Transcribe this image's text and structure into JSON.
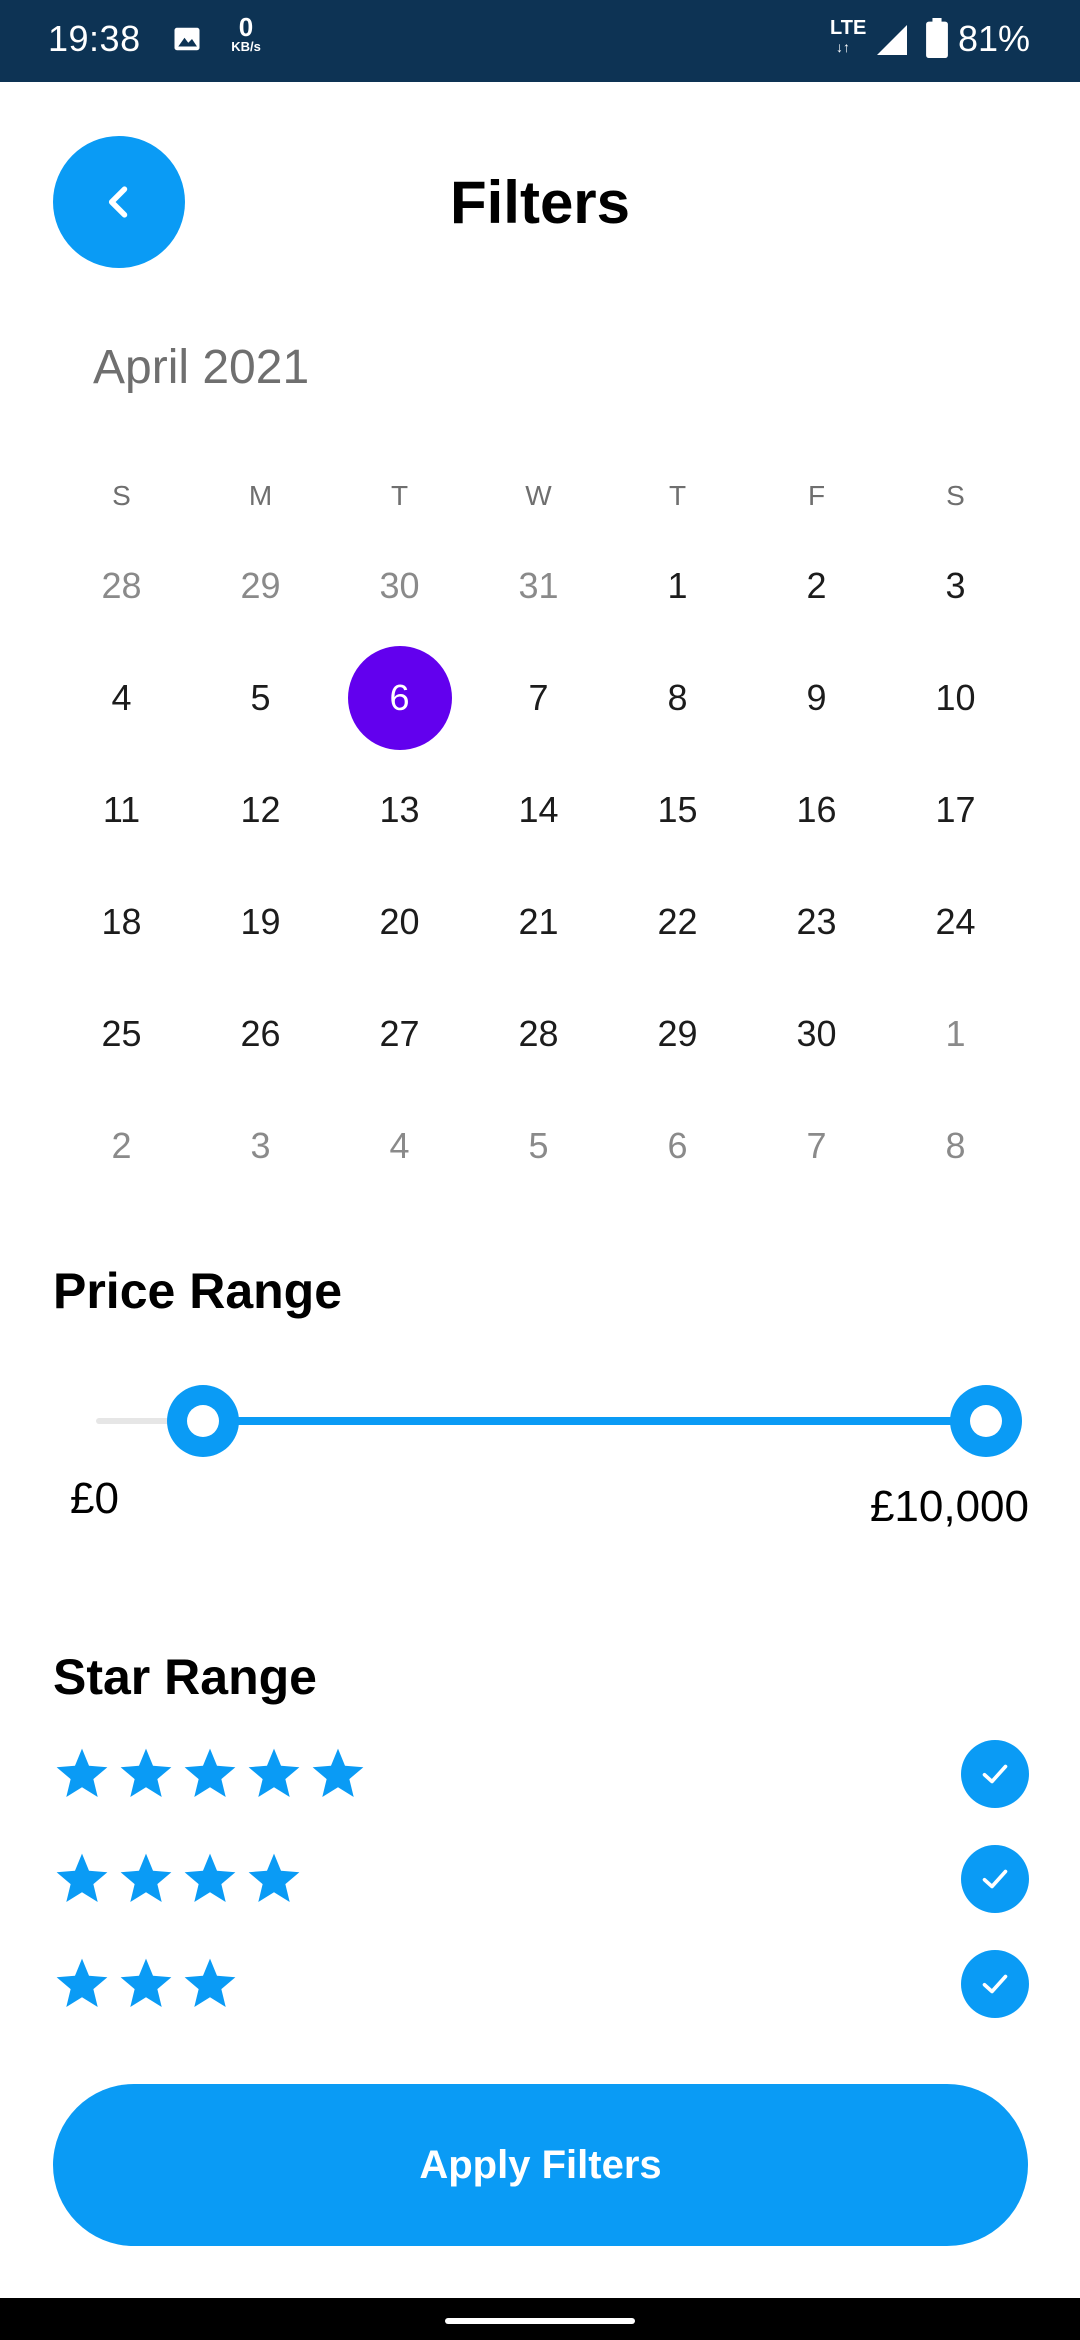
{
  "status_bar": {
    "time": "19:38",
    "speed_value": "0",
    "speed_unit": "KB/s",
    "network": "LTE",
    "network_arrows": "↓↑",
    "battery_percent": "81%",
    "icons": [
      "image-icon",
      "signal-icon",
      "battery-icon"
    ]
  },
  "header": {
    "title": "Filters",
    "back_icon": "chevron-left-icon"
  },
  "calendar": {
    "month_label": "April 2021",
    "weekdays": [
      "S",
      "M",
      "T",
      "W",
      "T",
      "F",
      "S"
    ],
    "selected_day": "6",
    "selected_color": "#6200ee",
    "weeks": [
      [
        "28",
        "29",
        "30",
        "31",
        "1",
        "2",
        "3"
      ],
      [
        "4",
        "5",
        "6",
        "7",
        "8",
        "9",
        "10"
      ],
      [
        "11",
        "12",
        "13",
        "14",
        "15",
        "16",
        "17"
      ],
      [
        "18",
        "19",
        "20",
        "21",
        "22",
        "23",
        "24"
      ],
      [
        "25",
        "26",
        "27",
        "28",
        "29",
        "30",
        "1"
      ],
      [
        "2",
        "3",
        "4",
        "5",
        "6",
        "7",
        "8"
      ]
    ]
  },
  "price_range": {
    "title": "Price Range",
    "min_label": "£0",
    "max_label": "£10,000",
    "range_start_fraction": 0.12,
    "range_end_fraction": 1.0
  },
  "star_range": {
    "title": "Star Range",
    "rows": [
      {
        "stars": 5,
        "checked": true
      },
      {
        "stars": 4,
        "checked": true
      },
      {
        "stars": 3,
        "checked": true
      }
    ]
  },
  "apply_button": {
    "label": "Apply Filters"
  },
  "colors": {
    "accent": "#0a9bf5",
    "status_bar": "#0d3354",
    "selected_day": "#6200ee"
  }
}
